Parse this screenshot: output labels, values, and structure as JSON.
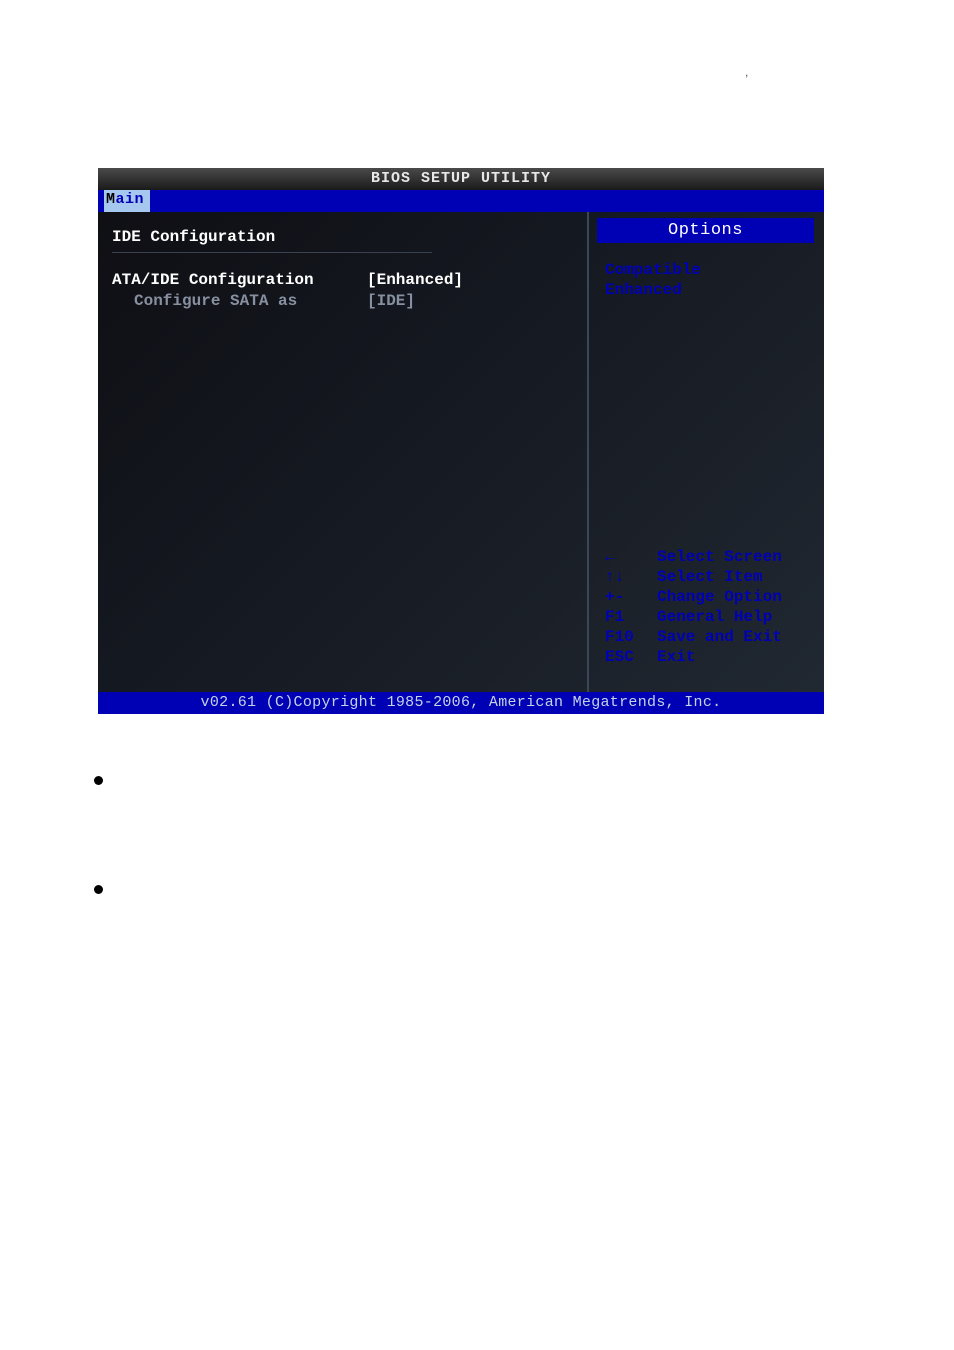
{
  "page": {
    "top_punctuation": ","
  },
  "bios": {
    "title": "BIOS SETUP UTILITY",
    "menu_tab": "Main",
    "footer": "v02.61 (C)Copyright 1985-2006, American Megatrends, Inc.",
    "section_heading": "IDE Configuration",
    "rows": [
      {
        "label": "ATA/IDE Configuration",
        "value": "[Enhanced]",
        "highlight": true
      },
      {
        "label": "Configure SATA as",
        "value": "[IDE]",
        "indent": true
      }
    ],
    "options_header": "Options",
    "options": [
      "Compatible",
      "Enhanced"
    ],
    "help": [
      {
        "key": "←",
        "desc": "Select Screen"
      },
      {
        "key": "↑↓",
        "desc": "Select Item"
      },
      {
        "key": "+-",
        "desc": "Change Option"
      },
      {
        "key": "F1",
        "desc": "General Help"
      },
      {
        "key": "F10",
        "desc": "Save and Exit"
      },
      {
        "key": "ESC",
        "desc": "Exit"
      }
    ]
  }
}
